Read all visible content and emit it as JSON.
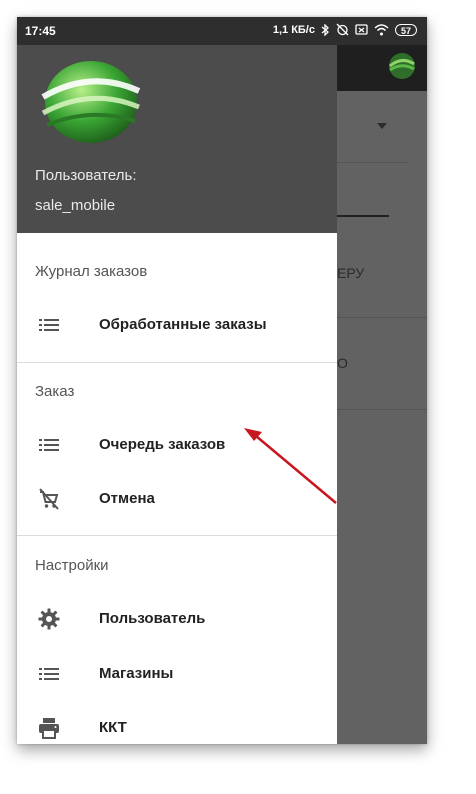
{
  "status_bar": {
    "time": "17:45",
    "speed": "1,1 КБ/с",
    "battery": "57"
  },
  "drawer": {
    "header": {
      "user_label": "Пользователь:",
      "username": "sale_mobile"
    },
    "sections": [
      {
        "title": "Журнал заказов",
        "items": [
          {
            "label": "Обработанные заказы",
            "icon": "list-icon"
          }
        ]
      },
      {
        "title": "Заказ",
        "items": [
          {
            "label": "Очередь заказов",
            "icon": "list-icon"
          },
          {
            "label": "Отмена",
            "icon": "remove-shopping-cart-icon"
          }
        ]
      },
      {
        "title": "Настройки",
        "items": [
          {
            "label": "Пользователь",
            "icon": "gear-icon"
          },
          {
            "label": "Магазины",
            "icon": "list-icon"
          },
          {
            "label": "ККТ",
            "icon": "printer-icon"
          }
        ]
      }
    ]
  },
  "background": {
    "text_1": "ЕРУ",
    "text_2": "О"
  },
  "colors": {
    "logo_green": "#3aa534",
    "annotation_arrow": "#c8171e"
  }
}
